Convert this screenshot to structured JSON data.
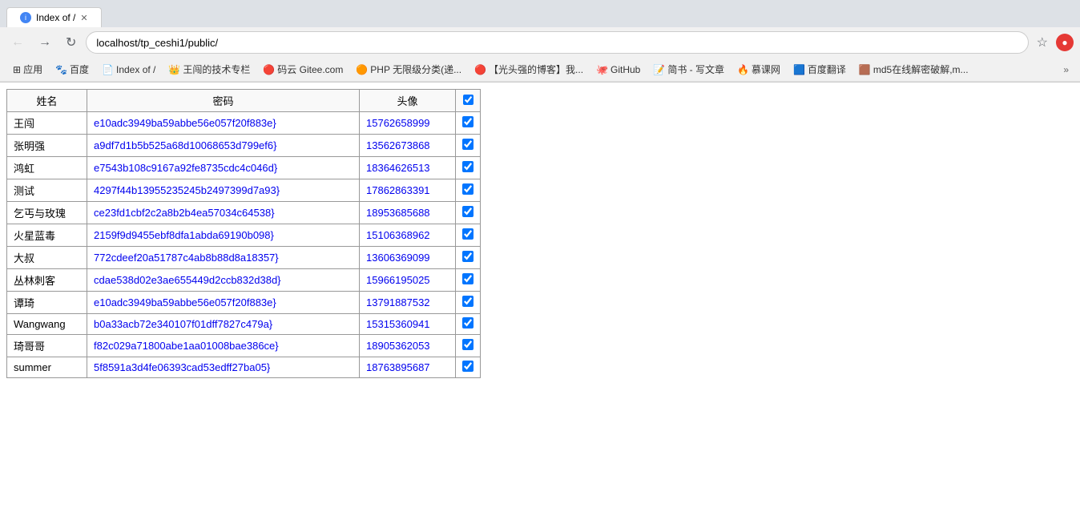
{
  "browser": {
    "tab_label": "Index of /",
    "url": "localhost/tp_ceshi1/public/",
    "star_icon": "★",
    "ext_icon": "●"
  },
  "bookmarks": [
    {
      "icon": "⊞",
      "label": "应用"
    },
    {
      "icon": "🐾",
      "label": "百度"
    },
    {
      "icon": "📄",
      "label": "Index of /"
    },
    {
      "icon": "👑",
      "label": "王闯的技术专栏"
    },
    {
      "icon": "🔴",
      "label": "码云 Gitee.com"
    },
    {
      "icon": "🟠",
      "label": "PHP 无限级分类(递..."
    },
    {
      "icon": "🔴",
      "label": "【光头强的博客】我..."
    },
    {
      "icon": "🐙",
      "label": "GitHub"
    },
    {
      "icon": "🟩",
      "label": "简书 - 写文章"
    },
    {
      "icon": "🔥",
      "label": "慕课网"
    },
    {
      "icon": "🟦",
      "label": "百度翻译"
    },
    {
      "icon": "🟫",
      "label": "md5在线解密破解,m..."
    }
  ],
  "table": {
    "headers": [
      "姓名",
      "密码",
      "头像",
      "✓"
    ],
    "rows": [
      {
        "name": "王闯",
        "password": "e10adc3949ba59abbe56e057f20f883e}",
        "avatar": "15762658999",
        "checked": true
      },
      {
        "name": "张明强",
        "password": "a9df7d1b5b525a68d10068653d799ef6}",
        "avatar": "13562673868",
        "checked": true
      },
      {
        "name": "鸿虹",
        "password": "e7543b108c9167a92fe8735cdc4c046d}",
        "avatar": "18364626513",
        "checked": true
      },
      {
        "name": "测试",
        "password": "4297f44b13955235245b2497399d7a93}",
        "avatar": "17862863391",
        "checked": true
      },
      {
        "name": "乞丐与玫瑰",
        "password": "ce23fd1cbf2c2a8b2b4ea57034c64538}",
        "avatar": "18953685688",
        "checked": true
      },
      {
        "name": "火星蓝毒",
        "password": "2159f9d9455ebf8dfa1abda69190b098}",
        "avatar": "15106368962",
        "checked": true
      },
      {
        "name": "大叔",
        "password": "772cdeef20a51787c4ab8b88d8a18357}",
        "avatar": "13606369099",
        "checked": true
      },
      {
        "name": "丛林刺客",
        "password": "cdae538d02e3ae655449d2ccb832d38d}",
        "avatar": "15966195025",
        "checked": true
      },
      {
        "name": "谭琦",
        "password": "e10adc3949ba59abbe56e057f20f883e}",
        "avatar": "13791887532",
        "checked": true
      },
      {
        "name": "Wangwang",
        "password": "b0a33acb72e340107f01dff7827c479a}",
        "avatar": "15315360941",
        "checked": true
      },
      {
        "name": "琦哥哥",
        "password": "f82c029a71800abe1aa01008bae386ce}",
        "avatar": "18905362053",
        "checked": true
      },
      {
        "name": "summer",
        "password": "5f8591a3d4fe06393cad53edff27ba05}",
        "avatar": "18763895687",
        "checked": true
      }
    ]
  },
  "page_title": "Index of /"
}
